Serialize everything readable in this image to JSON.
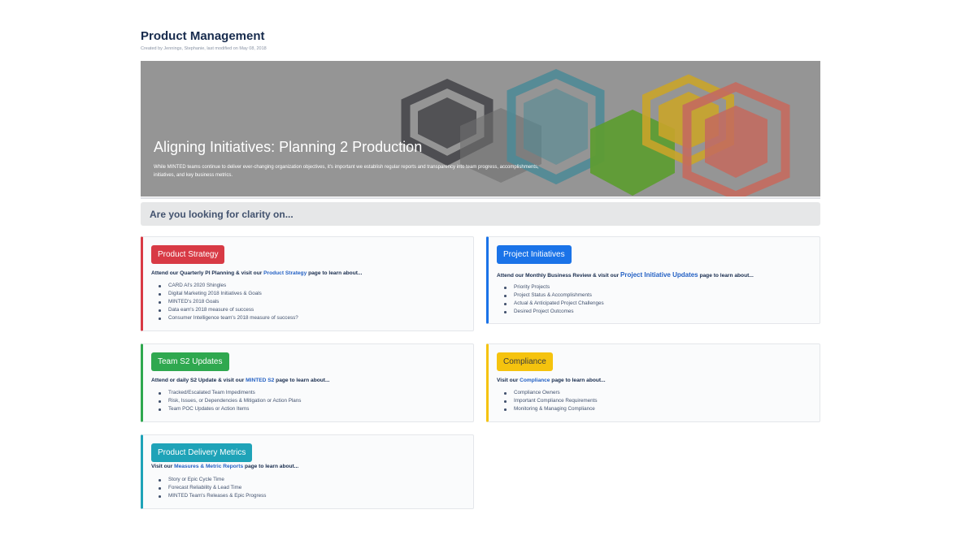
{
  "page": {
    "title": "Product Management",
    "byline": "Created by Jennings, Stephanie, last modified on May 08, 2018"
  },
  "hero": {
    "heading": "Aligning Initiatives: Planning 2 Production",
    "text": "While MINTED teams continue to deliver ever-changing organization objectives, it's important we establish regular reports and transparency into team progress, accomplishments, initiatives, and key business metrics."
  },
  "clarity": {
    "heading": "Are you looking for clarity on..."
  },
  "cards": {
    "product_strategy": {
      "badge": "Product Strategy",
      "color": "#d83a45",
      "intro_before": "Attend our Quarterly PI Planning & visit our ",
      "link": "Product Strategy",
      "intro_after": " page to learn about...",
      "items": [
        "CARD AI's 2020 Shingles",
        "Digital Marketing 2018 Initiatives & Goals",
        "MINTED's 2018 Goals",
        "Data eam's 2018 measure of success",
        "Consumer Intelligence team's 2018 measure of success?"
      ]
    },
    "project_initiatives": {
      "badge": "Project Initiatives",
      "color": "#1a73e8",
      "intro_before": "Attend our Monthly Business Review & visit our ",
      "link": "Project Initiative Updates",
      "intro_after": " page to learn about...",
      "items": [
        "Priority Projects",
        "Project Status & Accomplishments",
        "Actual & Anticipated Project Challenges",
        "Desired Project Outcomes"
      ]
    },
    "team_updates": {
      "badge": "Team S2 Updates",
      "color": "#2fa84f",
      "intro_before": "Attend or daily S2 Update & visit our ",
      "link": "MINTED S2",
      "intro_after": " page to learn about...",
      "items": [
        "Tracked/Escalated Team Impediments",
        "Risk, Issues, or Dependencies & Mitigation or Action Plans",
        "Team POC Updates or Action Items"
      ]
    },
    "compliance": {
      "badge": "Compliance",
      "color": "#f5c30e",
      "text_color": "#3d3d3d",
      "intro_before": "Visit our ",
      "link": "Compliance",
      "intro_after": " page to learn about...",
      "items": [
        "Compliance Owners",
        "Important Compliance Requirements",
        "Monitoring & Managing Compliance"
      ]
    },
    "delivery_metrics": {
      "badge": "Product Delivery Metrics",
      "color": "#1fa3b8",
      "intro_before": "Visit our ",
      "link": "Measures & Metric Reports",
      "intro_after": " page to learn about...",
      "items": [
        "Story or Epic Cycle Time",
        "Forecast Reliability & Lead Time",
        "MINTED Team's Releases & Epic Progress"
      ]
    }
  }
}
